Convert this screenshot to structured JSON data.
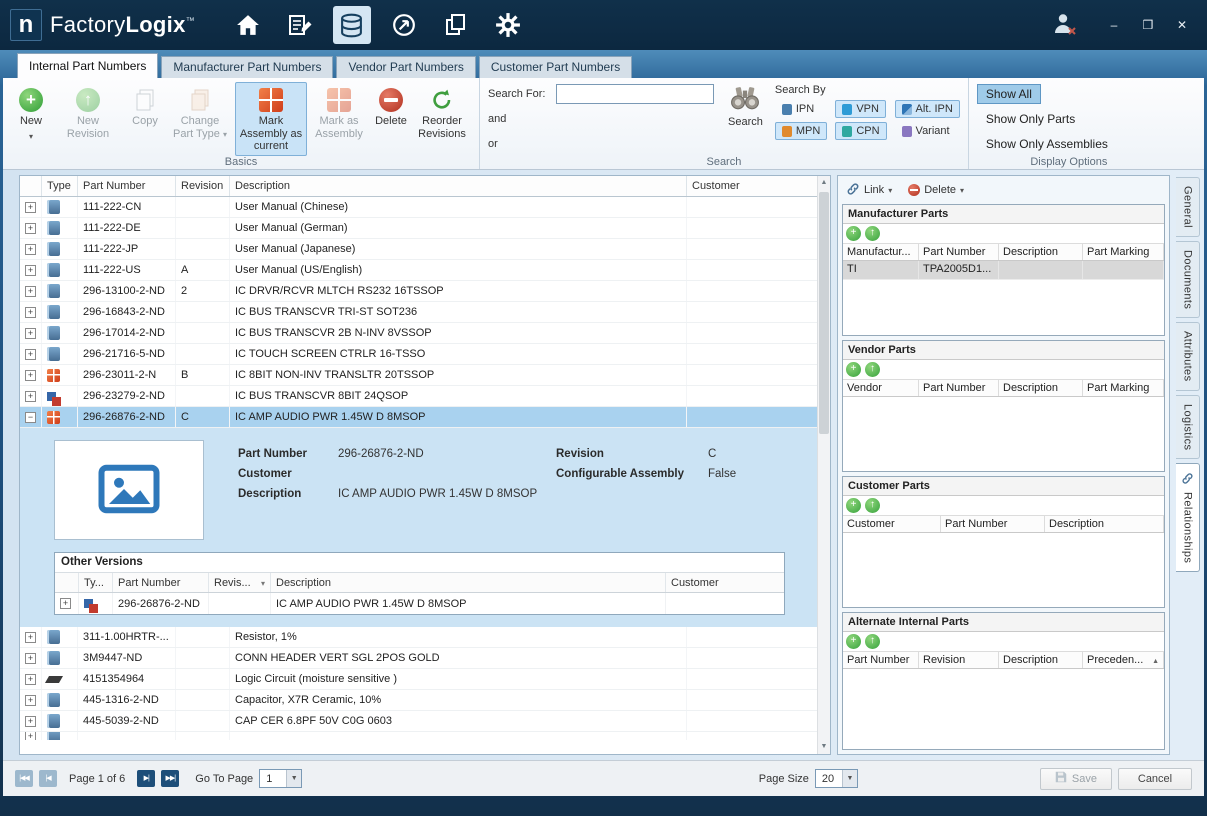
{
  "titlebar": {
    "logo_letter": "n",
    "app_name_regular": "Factory",
    "app_name_bold": "Logix",
    "trademark": "™",
    "nav_icons": [
      "home-icon",
      "worksheet-icon",
      "parts-library-icon",
      "navigate-icon",
      "documents-icon",
      "settings-icon"
    ],
    "window_icons": [
      "minimize-icon",
      "maximize-icon",
      "close-icon"
    ]
  },
  "tabs": [
    {
      "label": "Internal Part Numbers",
      "active": true
    },
    {
      "label": "Manufacturer Part Numbers",
      "active": false
    },
    {
      "label": "Vendor Part Numbers",
      "active": false
    },
    {
      "label": "Customer Part Numbers",
      "active": false
    }
  ],
  "ribbon": {
    "basics": {
      "label": "Basics",
      "new": "New",
      "new_revision": "New Revision",
      "copy": "Copy",
      "change_part_type": "Change Part Type",
      "mark_assembly_current": "Mark Assembly as current",
      "mark_as_assembly": "Mark as Assembly",
      "delete": "Delete",
      "reorder_revisions": "Reorder Revisions"
    },
    "search": {
      "label": "Search",
      "search_for": "Search For:",
      "and": "and",
      "or": "or",
      "search_value": "",
      "search_button": "Search",
      "search_by": "Search By",
      "filters": [
        {
          "label": "IPN",
          "active": false
        },
        {
          "label": "VPN",
          "active": true
        },
        {
          "label": "Alt. IPN",
          "active": true
        },
        {
          "label": "MPN",
          "active": true
        },
        {
          "label": "CPN",
          "active": true
        },
        {
          "label": "Variant",
          "active": false
        }
      ]
    },
    "display": {
      "label": "Display Options",
      "options": [
        {
          "label": "Show All",
          "active": true
        },
        {
          "label": "Show Only Parts",
          "active": false
        },
        {
          "label": "Show Only Assemblies",
          "active": false
        }
      ]
    }
  },
  "parts_table": {
    "columns": {
      "type": "Type",
      "part_number": "Part Number",
      "revision": "Revision",
      "description": "Description",
      "customer": "Customer"
    },
    "rows_top": [
      {
        "type": "part",
        "pn": "111-222-CN",
        "rev": "",
        "desc": "User Manual (Chinese)",
        "customer": ""
      },
      {
        "type": "part",
        "pn": "111-222-DE",
        "rev": "",
        "desc": "User Manual (German)",
        "customer": ""
      },
      {
        "type": "part",
        "pn": "111-222-JP",
        "rev": "",
        "desc": "User Manual (Japanese)",
        "customer": ""
      },
      {
        "type": "part",
        "pn": "111-222-US",
        "rev": "A",
        "desc": "User Manual (US/English)",
        "customer": ""
      },
      {
        "type": "part",
        "pn": "296-13100-2-ND",
        "rev": "2",
        "desc": "IC DRVR/RCVR MLTCH RS232 16TSSOP",
        "customer": ""
      },
      {
        "type": "part",
        "pn": "296-16843-2-ND",
        "rev": "",
        "desc": "IC BUS TRANSCVR TRI-ST SOT236",
        "customer": ""
      },
      {
        "type": "part",
        "pn": "296-17014-2-ND",
        "rev": "",
        "desc": "IC BUS TRANSCVR 2B N-INV 8VSSOP",
        "customer": ""
      },
      {
        "type": "part",
        "pn": "296-21716-5-ND",
        "rev": "",
        "desc": "IC TOUCH SCREEN CTRLR 16-TSSO",
        "customer": ""
      },
      {
        "type": "assembly",
        "pn": "296-23011-2-N",
        "rev": "B",
        "desc": "IC 8BIT NON-INV TRANSLTR 20TSSOP",
        "customer": ""
      },
      {
        "type": "variant",
        "pn": "296-23279-2-ND",
        "rev": "",
        "desc": "IC BUS TRANSCVR 8BIT 24QSOP",
        "customer": ""
      },
      {
        "type": "assembly",
        "pn": "296-26876-2-ND",
        "rev": "C",
        "desc": "IC AMP AUDIO PWR 1.45W D 8MSOP",
        "customer": "",
        "selected": true,
        "expanded": true
      }
    ],
    "rows_bottom": [
      {
        "type": "part",
        "pn": "311-1.00HRTR-...",
        "rev": "",
        "desc": "Resistor, 1%",
        "customer": ""
      },
      {
        "type": "part",
        "pn": "3M9447-ND",
        "rev": "",
        "desc": "CONN HEADER VERT SGL 2POS GOLD",
        "customer": ""
      },
      {
        "type": "chip",
        "pn": "4151354964",
        "rev": "",
        "desc": "Logic Circuit (moisture sensitive )",
        "customer": ""
      },
      {
        "type": "part",
        "pn": "445-1316-2-ND",
        "rev": "",
        "desc": "Capacitor, X7R Ceramic, 10%",
        "customer": ""
      },
      {
        "type": "part",
        "pn": "445-5039-2-ND",
        "rev": "",
        "desc": "CAP CER 6.8PF 50V C0G 0603",
        "customer": ""
      },
      {
        "type": "part",
        "pn": "",
        "rev": "",
        "desc": "",
        "customer": "",
        "partial": true
      }
    ]
  },
  "detail": {
    "part_number_label": "Part Number",
    "part_number": "296-26876-2-ND",
    "revision_label": "Revision",
    "revision": "C",
    "customer_label": "Customer",
    "customer": "",
    "configurable_assembly_label": "Configurable Assembly",
    "configurable_assembly": "False",
    "description_label": "Description",
    "description": "IC AMP AUDIO PWR 1.45W D 8MSOP"
  },
  "other_versions": {
    "title": "Other Versions",
    "columns": {
      "type": "Ty...",
      "part_number": "Part Number",
      "revision": "Revis...",
      "description": "Description",
      "customer": "Customer"
    },
    "rows": [
      {
        "type": "variant",
        "pn": "296-26876-2-ND",
        "rev": "",
        "desc": "IC AMP AUDIO PWR 1.45W D 8MSOP",
        "customer": ""
      }
    ]
  },
  "relations_panel": {
    "link_button": "Link",
    "delete_button": "Delete",
    "sections": [
      {
        "title": "Manufacturer Parts",
        "columns": [
          "Manufactur...",
          "Part Number",
          "Description",
          "Part Marking"
        ],
        "rows": [
          [
            "TI",
            "TPA2005D1...",
            "",
            ""
          ]
        ],
        "selected_row": 0
      },
      {
        "title": "Vendor Parts",
        "columns": [
          "Vendor",
          "Part Number",
          "Description",
          "Part Marking"
        ],
        "rows": []
      },
      {
        "title": "Customer Parts",
        "columns": [
          "Customer",
          "Part Number",
          "Description"
        ],
        "rows": []
      },
      {
        "title": "Alternate Internal Parts",
        "columns": [
          "Part Number",
          "Revision",
          "Description",
          "Preceden..."
        ],
        "rows": [],
        "has_toolbar": true,
        "sorted_col": 3
      }
    ]
  },
  "side_tabs": [
    {
      "label": "General",
      "active": false
    },
    {
      "label": "Documents",
      "active": false
    },
    {
      "label": "Attributes",
      "active": false
    },
    {
      "label": "Logistics",
      "active": false
    },
    {
      "label": "Relationships",
      "active": true,
      "icon": "link-icon"
    }
  ],
  "footer": {
    "page_text": "Page 1 of 6",
    "go_to_page_label": "Go To Page",
    "go_to_page_value": "1",
    "page_size_label": "Page Size",
    "page_size_value": "20",
    "save": "Save",
    "cancel": "Cancel"
  }
}
